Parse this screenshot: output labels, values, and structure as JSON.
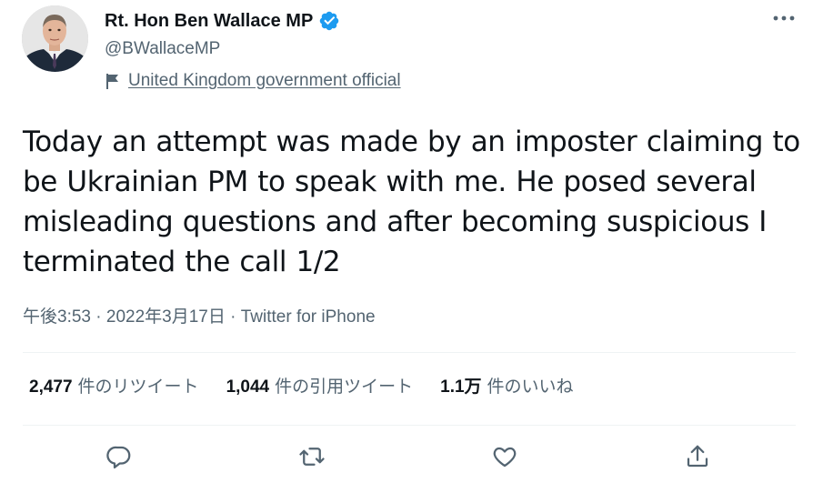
{
  "user": {
    "display_name": "Rt. Hon Ben Wallace MP",
    "handle": "@BWallaceMP",
    "label": "United Kingdom government official",
    "verified": true
  },
  "tweet": {
    "lines": [
      "Today an attempt was made by an imposter claiming to",
      "be Ukrainian PM to speak with me. He posed several",
      "misleading questions and after becoming suspicious I",
      "terminated the call 1/2"
    ],
    "time": "午後3:53",
    "date": "2022年3月17日",
    "source": "Twitter for iPhone",
    "separator": " · "
  },
  "stats": {
    "retweets_count": "2,477",
    "retweets_label": "件のリツイート",
    "quotes_count": "1,044",
    "quotes_label": "件の引用ツイート",
    "likes_count": "1.1万",
    "likes_label": "件のいいね"
  },
  "icons": {
    "more": "more-horizontal-icon",
    "reply": "reply-icon",
    "retweet": "retweet-icon",
    "like": "heart-icon",
    "share": "share-icon",
    "verified": "verified-badge-icon",
    "flag": "flag-icon"
  },
  "colors": {
    "accent": "#1d9bf0",
    "secondary_text": "#536471",
    "primary_text": "#0f1419",
    "divider": "#eff3f4"
  }
}
